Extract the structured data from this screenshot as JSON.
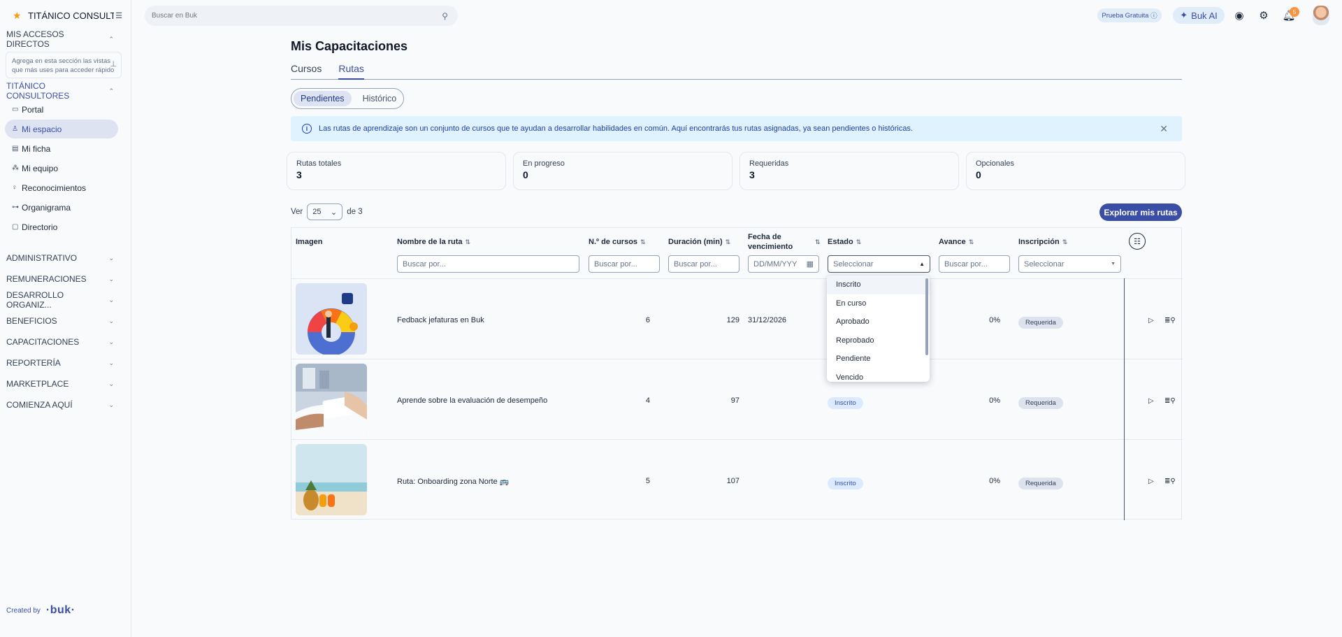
{
  "app": {
    "company": "TITÁNICO CONSULT...",
    "search_placeholder": "Buscar en Buk",
    "trial_label": "Prueba Gratuita",
    "ai_label": "Buk AI",
    "notifications_count": "5",
    "footer_created_by": "Created by",
    "footer_logo": "·buk·"
  },
  "sidebar": {
    "shortcuts_title": "MIS ACCESOS DIRECTOS",
    "shortcuts_hint": "Agrega en esta sección las vistas que más uses para acceder rápido",
    "company_section": "TITÁNICO CONSULTORES",
    "items": [
      {
        "label": "Portal",
        "icon": "portal-icon"
      },
      {
        "label": "Mi espacio",
        "icon": "user-icon"
      },
      {
        "label": "Mi ficha",
        "icon": "file-icon"
      },
      {
        "label": "Mi equipo",
        "icon": "team-icon"
      },
      {
        "label": "Reconocimientos",
        "icon": "award-icon"
      },
      {
        "label": "Organigrama",
        "icon": "org-icon"
      },
      {
        "label": "Directorio",
        "icon": "folder-icon"
      }
    ],
    "groups": [
      "ADMINISTRATIVO",
      "REMUNERACIONES",
      "DESARROLLO ORGANIZ...",
      "BENEFICIOS",
      "CAPACITACIONES",
      "REPORTERÍA",
      "MARKETPLACE",
      "COMIENZA AQUÍ"
    ]
  },
  "main": {
    "title": "Mis Capacitaciones",
    "tabs": [
      "Cursos",
      "Rutas"
    ],
    "segments": [
      "Pendientes",
      "Histórico"
    ],
    "info": "Las rutas de aprendizaje son un conjunto de cursos que te ayudan a desarrollar habilidades en común. Aquí encontrarás tus rutas asignadas, ya sean pendientes o históricas.",
    "stats": [
      {
        "label": "Rutas totales",
        "value": "3"
      },
      {
        "label": "En progreso",
        "value": "0"
      },
      {
        "label": "Requeridas",
        "value": "3"
      },
      {
        "label": "Opcionales",
        "value": "0"
      }
    ],
    "pager": {
      "prefix": "Ver",
      "size": "25",
      "suffix": "de 3"
    },
    "explore_button": "Explorar mis rutas"
  },
  "table": {
    "headers": {
      "image": "Imagen",
      "name": "Nombre de la ruta",
      "courses": "N.º de cursos",
      "duration": "Duración (min)",
      "due_1": "Fecha de",
      "due_2": "vencimiento",
      "state": "Estado",
      "progress": "Avance",
      "enrollment": "Inscripción"
    },
    "filters": {
      "search": "Buscar por...",
      "date": "DD/MM/YYY",
      "select": "Seleccionar"
    },
    "rows": [
      {
        "name": "Fedback jefaturas en Buk",
        "courses": "6",
        "duration": "129",
        "due": "31/12/2026",
        "state": "",
        "progress": "0%",
        "enrollment": "Requerida"
      },
      {
        "name": "Aprende sobre la evaluación de desempeño",
        "courses": "4",
        "duration": "97",
        "due": "",
        "state": "Inscrito",
        "progress": "0%",
        "enrollment": "Requerida"
      },
      {
        "name": "Ruta: Onboarding zona Norte 🚌",
        "courses": "5",
        "duration": "107",
        "due": "",
        "state": "Inscrito",
        "progress": "0%",
        "enrollment": "Requerida"
      }
    ],
    "state_options": [
      "Inscrito",
      "En curso",
      "Aprobado",
      "Reprobado",
      "Pendiente",
      "Vencido"
    ]
  },
  "colors": {
    "accent": "#3b4ea6",
    "info_bg": "#e0f2fe",
    "badge": "#fb923c"
  }
}
